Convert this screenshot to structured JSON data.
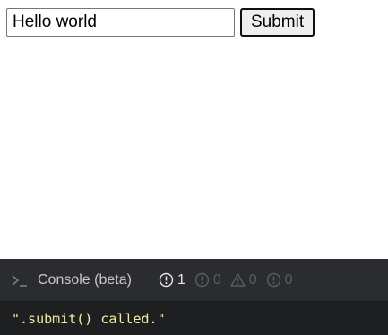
{
  "form": {
    "input_value": "Hello world",
    "submit_label": "Submit"
  },
  "console": {
    "title": "Console (beta)",
    "counts": {
      "info": "1",
      "error": "0",
      "warning": "0",
      "log": "0"
    },
    "output": "\".submit() called.\""
  }
}
